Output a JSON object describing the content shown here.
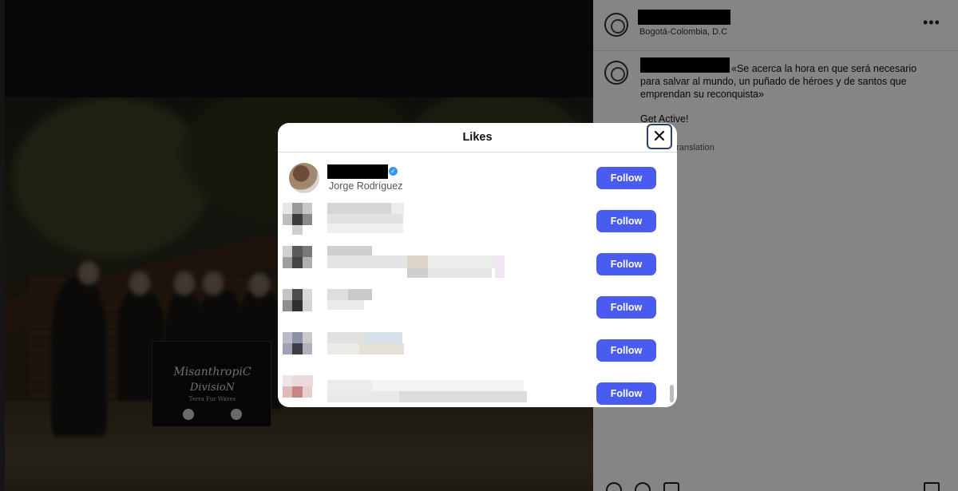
{
  "sidebar": {
    "location": "Bogotá-Colombia, D.C",
    "more_glyph": "•••",
    "caption": "«Se acerca la hora en que será necesario para salvar al mundo, un puñado de héroes y de santos que emprendan su reconquista»",
    "caption_extra": "Get Active!",
    "translation_link": "translation"
  },
  "photo": {
    "banner_line1": "MisanthropiC",
    "banner_line2": "DivisioN",
    "banner_line3": "Terra Fur Waves"
  },
  "modal": {
    "title": "Likes",
    "close_glyph": "✕",
    "first_user_fullname": "Jorge Rodríguez",
    "verified_glyph": "✓",
    "follow_label": "Follow"
  },
  "colors": {
    "follow_button": "#4a5cf0",
    "verified_badge": "#3897f0"
  },
  "icons": [
    "close-icon",
    "verified-badge-icon",
    "more-options-icon",
    "profile-emblem-icon"
  ]
}
